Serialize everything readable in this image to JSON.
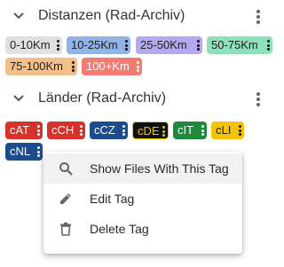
{
  "sections": [
    {
      "title": "Distanzen (Rad-Archiv)",
      "chips": [
        {
          "label": "0-10Km",
          "color": "#e0e0e0"
        },
        {
          "label": "10-25Km",
          "color": "#90b4e8"
        },
        {
          "label": "25-50Km",
          "color": "#b4a8f0"
        },
        {
          "label": "50-75Km",
          "color": "#8ee0bb"
        },
        {
          "label": "75-100Km",
          "color": "#f4c08a"
        },
        {
          "label": "100+Km",
          "color": "#f47a72"
        }
      ]
    },
    {
      "title": "Länder (Rad-Archiv)",
      "chips": [
        {
          "label": "cAT",
          "color": "#d83129"
        },
        {
          "label": "cCH",
          "color": "#d83129"
        },
        {
          "label": "cCZ",
          "color": "#1b4c8e"
        },
        {
          "label": "cDE",
          "color": "#111111"
        },
        {
          "label": "cIT",
          "color": "#1f8a3c"
        },
        {
          "label": "cLI",
          "color": "#f5c400"
        },
        {
          "label": "cNL",
          "color": "#1b4c8e"
        }
      ]
    }
  ],
  "context_menu": {
    "items": [
      {
        "label": "Show Files With This Tag",
        "icon": "search-icon"
      },
      {
        "label": "Edit Tag",
        "icon": "pencil-icon"
      },
      {
        "label": "Delete Tag",
        "icon": "trash-icon"
      }
    ]
  }
}
